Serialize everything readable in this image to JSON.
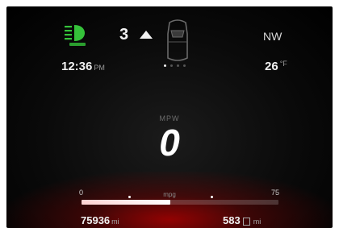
{
  "status": {
    "gear": "3",
    "heading": "NW",
    "time": "12:36",
    "time_suffix": "PM",
    "temperature": "26",
    "temperature_unit": "°F"
  },
  "icons": {
    "headlamp": "headlamp-auto-icon",
    "gear_arrow": "triangle-up-icon",
    "car": "car-topview-icon",
    "fuel": "fuel-pump-icon"
  },
  "colors": {
    "headlamp_indicator": "#35c23a",
    "accent_red": "#b00000"
  },
  "page_indicator": {
    "count": 4,
    "active_index": 0
  },
  "display": {
    "label": "MPW",
    "value": "0"
  },
  "gauge": {
    "min_label": "0",
    "max_label": "75",
    "unit": "mpg",
    "fill_fraction": 0.45
  },
  "odometer": {
    "value": "75936",
    "unit": "mi"
  },
  "range": {
    "value": "583",
    "unit": "mi"
  }
}
